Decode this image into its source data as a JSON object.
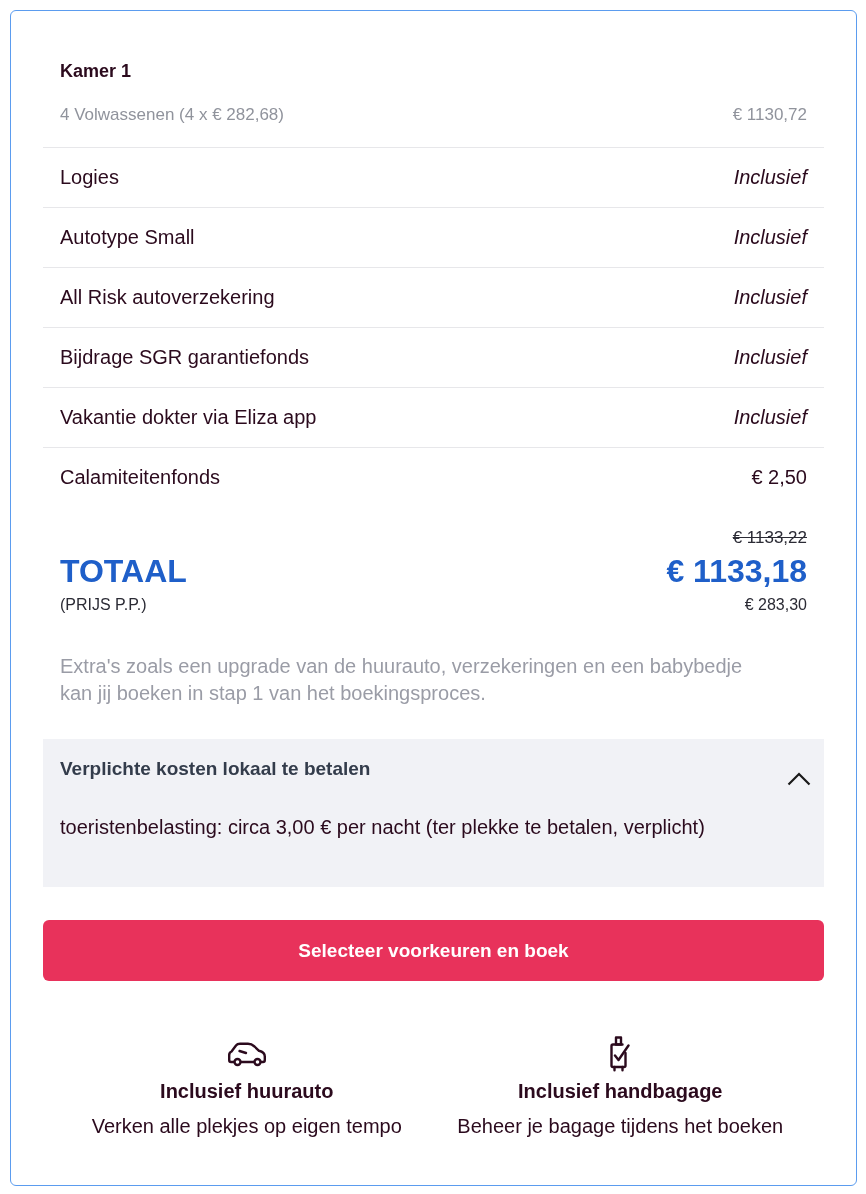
{
  "room": {
    "title": "Kamer 1",
    "guests": "4 Volwassenen (4 x € 282,68)",
    "guests_price": "€ 1130,72"
  },
  "items": [
    {
      "label": "Logies",
      "value": "Inclusief",
      "kind": "included"
    },
    {
      "label": "Autotype Small",
      "value": "Inclusief",
      "kind": "included"
    },
    {
      "label": "All Risk autoverzekering",
      "value": "Inclusief",
      "kind": "included"
    },
    {
      "label": "Bijdrage SGR garantiefonds",
      "value": "Inclusief",
      "kind": "included"
    },
    {
      "label": "Vakantie dokter via Eliza app",
      "value": "Inclusief",
      "kind": "included"
    },
    {
      "label": "Calamiteitenfonds",
      "value": "€ 2,50",
      "kind": "price"
    }
  ],
  "total": {
    "label": "TOTAAL",
    "old_price": "€ 1133,22",
    "price": "€ 1133,18",
    "per_person_label": "(PRIJS P.P.)",
    "per_person_price": "€ 283,30"
  },
  "note": "Extra's zoals een upgrade van de huurauto, verzekeringen en een babybedje kan jij boeken in stap 1 van het boekingsproces.",
  "local_costs": {
    "title": "Verplichte kosten lokaal te betalen",
    "expanded": true,
    "text": "toeristenbelasting: circa 3,00 € per nacht (ter plekke te betalen, verplicht)"
  },
  "book_button": "Selecteer voorkeuren en boek",
  "features": [
    {
      "title": "Inclusief huurauto",
      "text": "Verken alle plekjes op eigen tempo"
    },
    {
      "title": "Inclusief handbagage",
      "text": "Beheer je bagage tijdens het boeken"
    }
  ]
}
